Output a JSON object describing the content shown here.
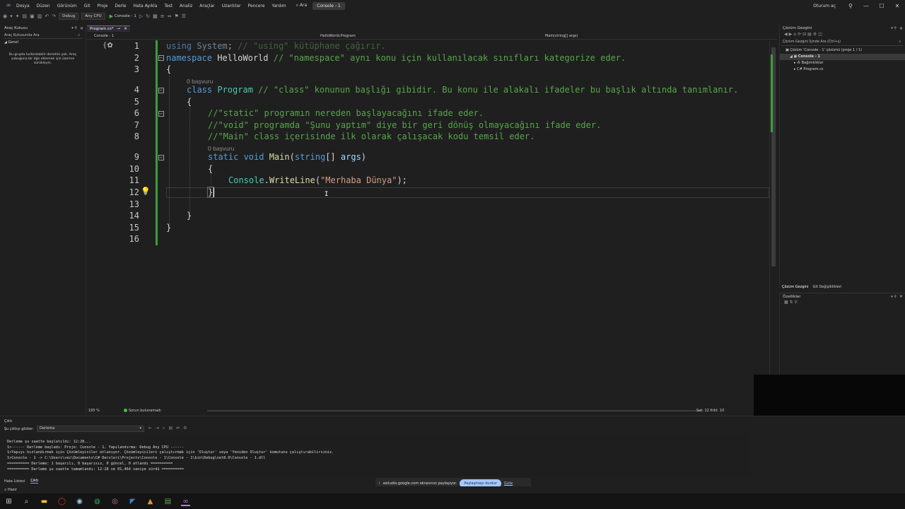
{
  "menu": {
    "items": [
      "Dosya",
      "Düzen",
      "Görünüm",
      "Git",
      "Proje",
      "Derle",
      "Hata Ayıkla",
      "Test",
      "Analiz",
      "Araçlar",
      "Uzantılar",
      "Pencere",
      "Yardım"
    ],
    "search_label": "Ara",
    "project_name": "Console - 1"
  },
  "window": {
    "user": "Oturum aç"
  },
  "toolbar": {
    "config": "Debug",
    "platform": "Any CPU",
    "run_label": "Console - 1"
  },
  "toolbox": {
    "title": "Araç Kutusu",
    "search_placeholder": "Araç Kutusunda Ara",
    "category": "Genel",
    "message": "Bu grupta kullanılabilir denetim yok. Araç çubuğuna bir öğe eklemek için üzerine sürükleyin."
  },
  "editor": {
    "tab_label": "Program.cs*",
    "tab_close": "✕",
    "nav_project": "Console - 1",
    "nav_class": "HelloWorld.Program",
    "nav_member": "Main(string[] args)",
    "lens_refs": "0 başvuru",
    "line_numbers": [
      "1",
      "2",
      "3",
      "4",
      "5",
      "6",
      "7",
      "8",
      "9",
      "10",
      "11",
      "12",
      "13",
      "14",
      "15",
      "16"
    ],
    "lines": {
      "l1_kw": "using",
      "l1_ty": " System",
      "l1_pl": ";",
      "l1_cm": " // \"using\" kütüphane çağırır.",
      "l2_kw": "namespace",
      "l2_ty": " HelloWorld",
      "l2_cm": " // \"namespace\" aynı konu için kullanılacak sınıfları kategorize eder.",
      "l3": "{",
      "l4_kw": "class",
      "l4_ty": " Program",
      "l4_cm": " // \"class\" konunun başlığı gibidir. Bu konu ile alakalı ifadeler bu başlık altında tanımlanır.",
      "l5": "{",
      "l6_cm": "//\"static\" programın nereden başlayacağını ifade eder.",
      "l7_cm": "//\"void\" programda \"Şunu yaptım\" diye bir geri dönüş olmayacağını ifade eder.",
      "l8_cm": "//\"Main\" class içerisinde ilk olarak çalışacak kodu temsil eder.",
      "l9_kw": "static void",
      "l9_me": " Main",
      "l9_pl1": "(",
      "l9_kw2": "string",
      "l9_pl2": "[] ",
      "l9_pa": "args",
      "l9_pl3": ")",
      "l10": "{",
      "l11_ty": "Console",
      "l11_pl1": ".",
      "l11_me": "WriteLine",
      "l11_pl2": "(",
      "l11_st": "\"Merhaba Dünya\"",
      "l11_pl3": ");",
      "l12": "}",
      "l14": "}",
      "l15": "}"
    },
    "zoom": "195 %",
    "issues": "Sorun bulunamadı",
    "position": "Sat: 12    Krkt: 10"
  },
  "solution": {
    "title": "Çözüm Gezgini",
    "search_placeholder": "Çözüm Gezgini İçinde Ara (Ctrl+ş)",
    "tree": [
      "Çözüm 'Console - 1' çözümü (proje 1 / 1)",
      "Console - 1",
      "Bağımlılıklar",
      "Program.cs"
    ],
    "tabs": [
      "Çözüm Gezgini",
      "Git Değişiklikleri"
    ]
  },
  "properties": {
    "title": "Özellikler"
  },
  "output": {
    "title": "Çıktı",
    "show_label": "Şu çıktıyı göster:",
    "source": "Derleme",
    "lines": [
      "Derleme şu saatte başlatıldı: 12:28...",
      "1>------ Derleme başladı: Proje: Console - 1, Yapılandırma: Debug Any CPU ------",
      "1>Yapıyı hızlandırmak için Çözümleyiciler atlanıyor. Çözümleyicileri çalıştırmak için 'Oluştur' veya 'Yeniden Oluştur' komutunu çalıştırabilirsiniz.",
      "1>Console - 1 -> C:\\Users\\vec\\Documents\\C# Dersleri\\Projects\\Console - 1\\Console - 1\\bin\\Debug\\net8.0\\Console - 1.dll",
      "========== Derleme: 1 başarılı, 0 başarısız, 0 güncel, 0 atlandı ==========",
      "========== Derleme şu saatte tamamlandı: 12:28 ve 01,464 saniye sürdü =========="
    ]
  },
  "bottom_tabs": [
    "Hata Listesi",
    "Çıktı"
  ],
  "status": {
    "ready": "Hazır"
  },
  "share": {
    "text": "aistudio.google.com ekranınızı paylaşıyor.",
    "stop": "Paylaşmayı durdur",
    "hide": "Gizle"
  },
  "taskbar": {
    "icons": [
      "windows-icon",
      "search-icon",
      "file-explorer-icon",
      "opera-icon",
      "steam-icon",
      "chrome-icon",
      "opera-gx-icon",
      "vscode-icon",
      "office-icon",
      "notepad-icon",
      "visual-studio-icon"
    ]
  }
}
